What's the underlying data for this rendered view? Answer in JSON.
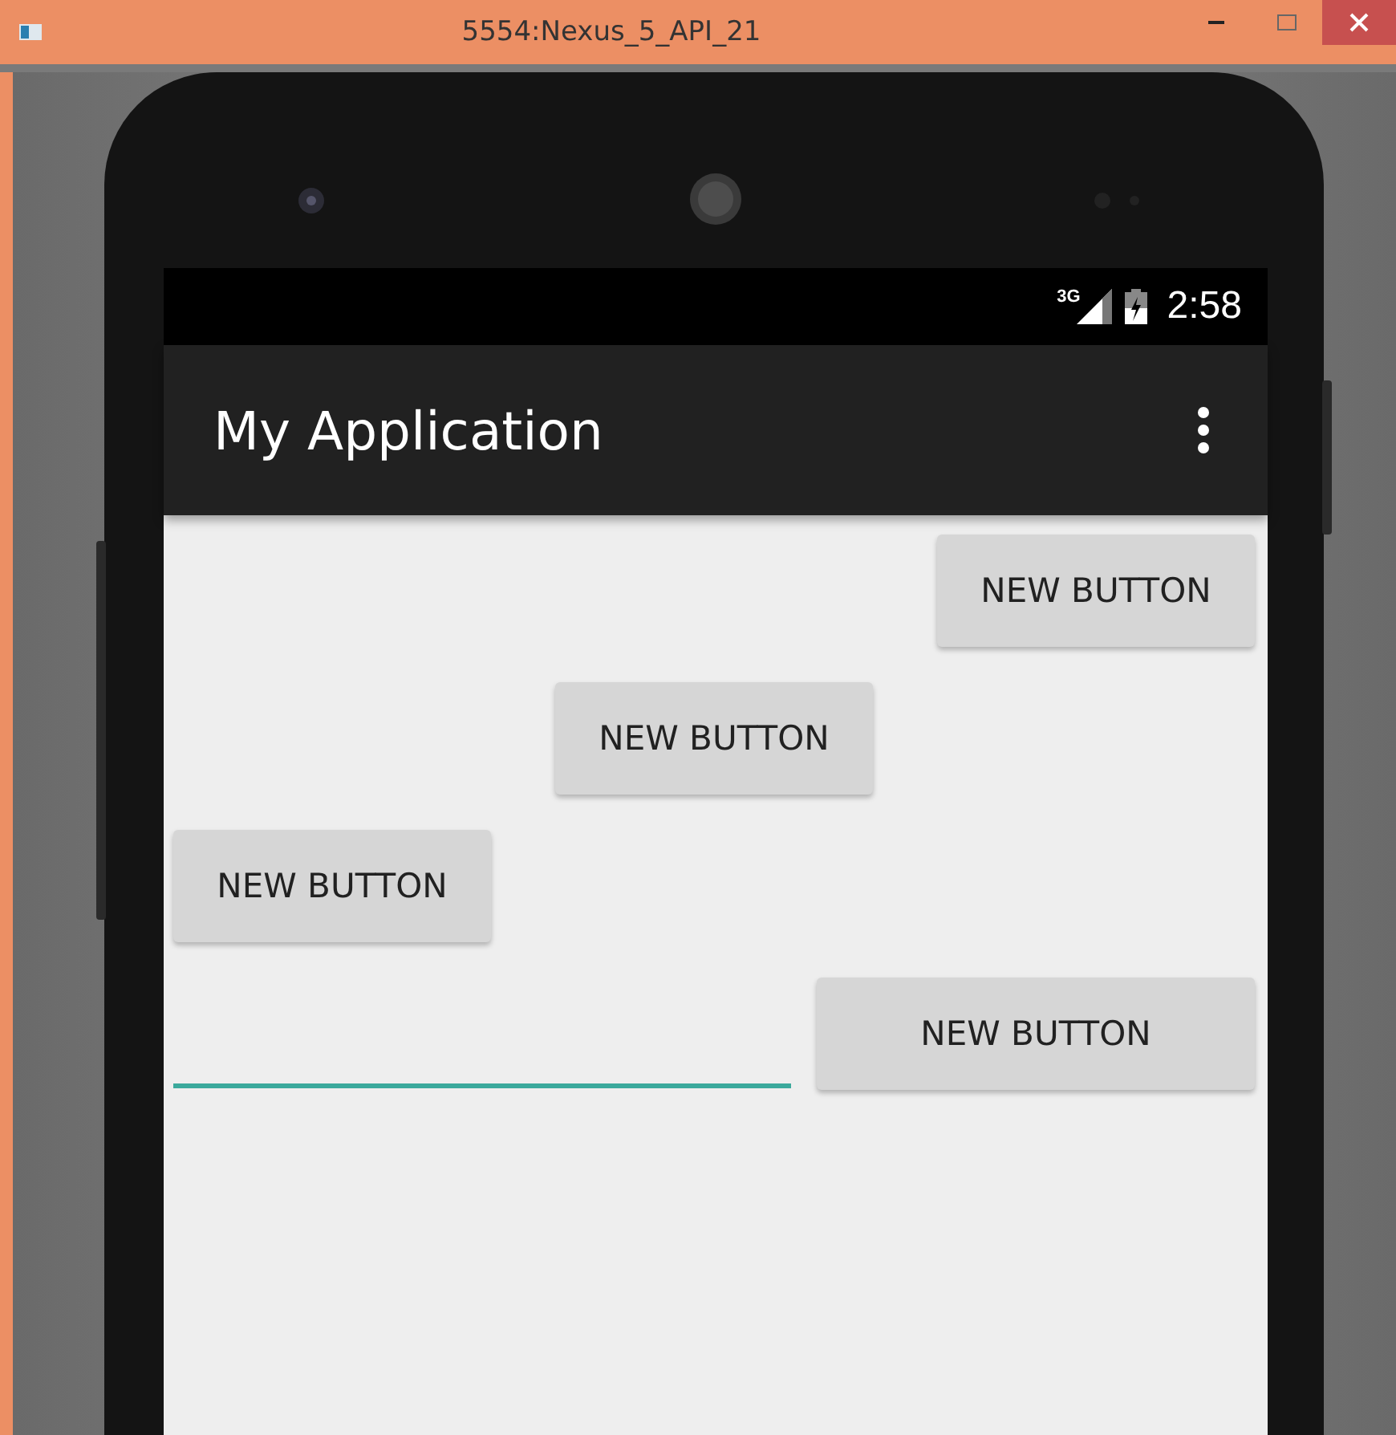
{
  "window": {
    "title": "5554:Nexus_5_API_21"
  },
  "status_bar": {
    "network": "3G",
    "time": "2:58"
  },
  "app_bar": {
    "title": "My Application"
  },
  "rows": [
    {
      "kind": "end",
      "buttons": [
        {
          "label": "NEW BUTTON"
        }
      ]
    },
    {
      "kind": "center",
      "buttons": [
        {
          "label": "NEW BUTTON"
        }
      ]
    },
    {
      "kind": "start",
      "buttons": [
        {
          "label": "NEW BUTTON"
        }
      ]
    },
    {
      "kind": "field",
      "field": {
        "focused": true
      },
      "buttons": [
        {
          "label": "NEW BUTTON"
        }
      ]
    }
  ]
}
